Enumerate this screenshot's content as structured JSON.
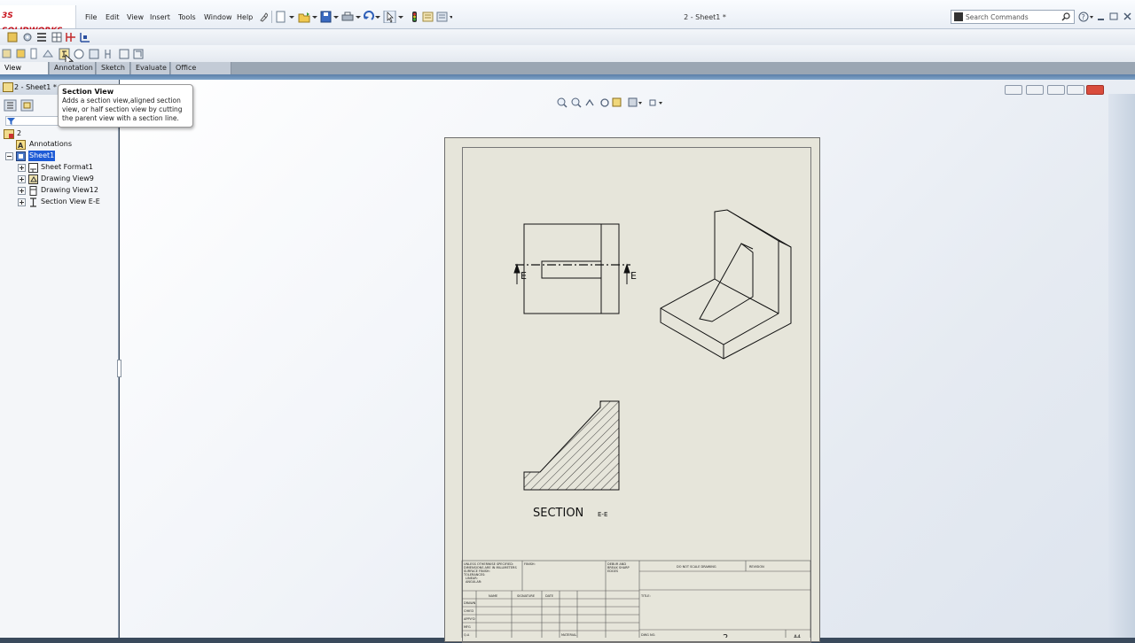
{
  "app": {
    "logo": "SOLIDWORKS",
    "logo_mark": "3S",
    "document_title": "2 - Sheet1 *"
  },
  "menu": [
    "File",
    "Edit",
    "View",
    "Insert",
    "Tools",
    "Window",
    "Help"
  ],
  "search": {
    "placeholder": "Search Commands"
  },
  "tabs": [
    "View Layout",
    "Annotation",
    "Sketch",
    "Evaluate",
    "Office Products"
  ],
  "active_tab": "View Layout",
  "tooltip": {
    "title": "Section View",
    "description": "Adds a section view,aligned section view, or half section view by cutting the parent view with a section line."
  },
  "tree": {
    "header": "2 - Sheet1 *",
    "root": "2",
    "items": [
      "Annotations",
      "Sheet1",
      "Sheet Format1",
      "Drawing View9",
      "Drawing View12",
      "Section View E-E"
    ]
  },
  "drawing": {
    "section_marker": "E",
    "section_label": "SECTION",
    "section_suffix": "E-E",
    "title_block_note": "DO NOT SCALE DRAWING",
    "revision": "REVISION",
    "sheet_size": "A4",
    "dwg_no_label": "DWG NO.",
    "dwg_no": "2",
    "material_label": "MATERIAL",
    "title_label": "TITLE:",
    "finish_label": "FINISH:",
    "edges_label": "DEBUR AND BREAK SHARP EDGES",
    "unless_text": "UNLESS OTHERWISE SPECIFIED: DIMENSIONS ARE IN MILLIMETERS SURFACE FINISH: TOLERANCES: LINEAR: ANGULAR:",
    "col_name": "NAME",
    "col_signature": "SIGNATURE",
    "col_date": "DATE",
    "rows": [
      "DRAWN",
      "CHK'D",
      "APPV'D",
      "MFG",
      "Q.A"
    ]
  },
  "colors": {
    "sheet": "#e6e5da",
    "selection": "#1e5bd6",
    "logo": "#c8141e",
    "close": "#d94c3c"
  }
}
